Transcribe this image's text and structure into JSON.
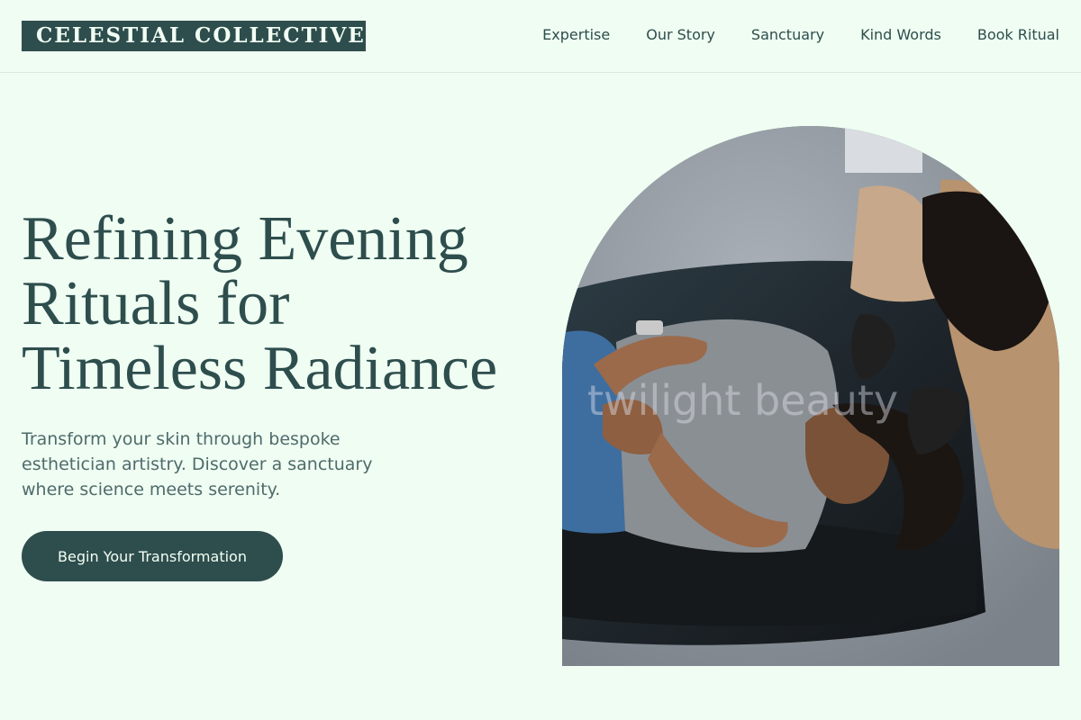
{
  "brand": {
    "name": "CELESTIAL COLLECTIVE"
  },
  "nav": {
    "items": [
      {
        "label": "Expertise"
      },
      {
        "label": "Our Story"
      },
      {
        "label": "Sanctuary"
      },
      {
        "label": "Kind Words"
      },
      {
        "label": "Book Ritual"
      }
    ]
  },
  "hero": {
    "title_lines": [
      "Refining Evening",
      "Rituals for",
      "Timeless Radiance"
    ],
    "subtitle": "Transform your skin through bespoke esthetician artistry. Discover a sanctuary where science meets serenity.",
    "cta_label": "Begin Your Transformation",
    "image": {
      "watermark": "twilight beauty"
    }
  },
  "colors": {
    "background": "#effdf2",
    "brand": "#2e4d4d",
    "text_muted": "#4f6b6b",
    "button_text": "#f2fff4"
  }
}
